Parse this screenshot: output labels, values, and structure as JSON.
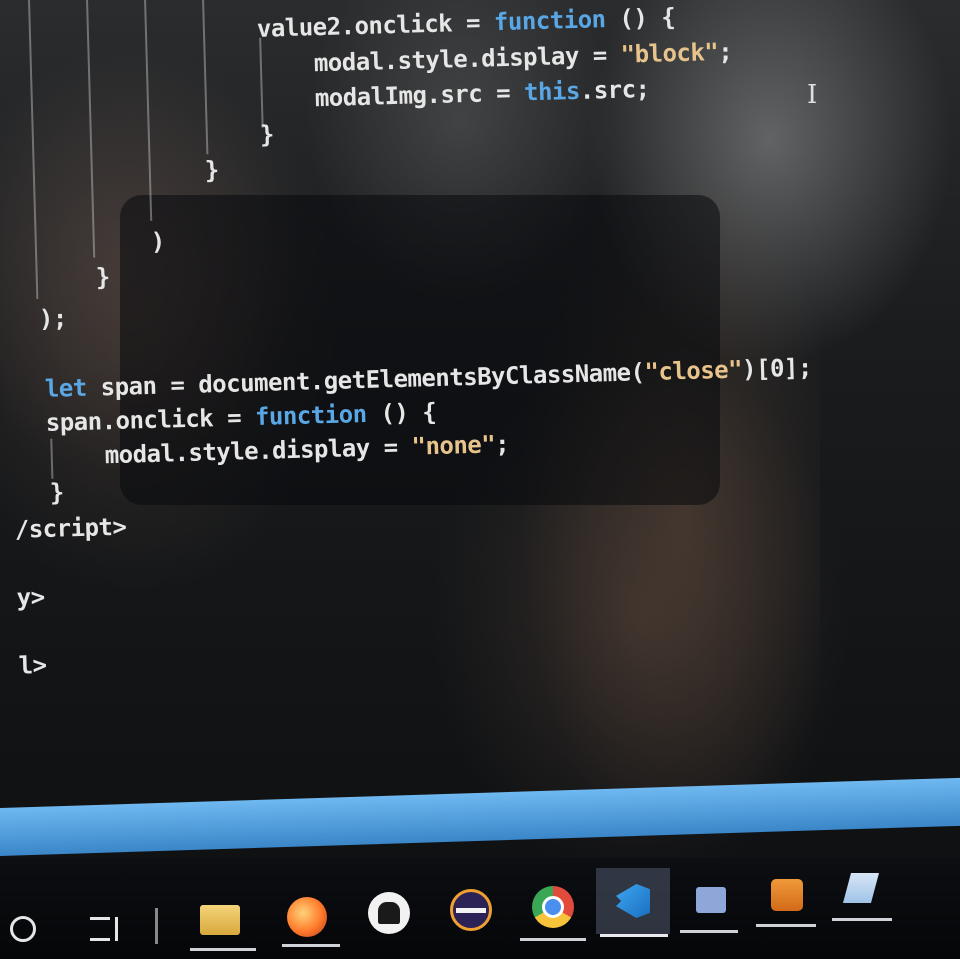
{
  "code": {
    "line1": "value2.onclick = ",
    "line1_kw": "function",
    "line1_tail": " () {",
    "line2_a": "modal.style.display = ",
    "line2_str": "\"block\"",
    "line2_end": ";",
    "line3_a": "modalImg.src = ",
    "line3_kw": "this",
    "line3_tail": ".src;",
    "close_brace_1": "}",
    "close_brace_2": "}",
    "close_paren": ")",
    "close_brace_3": "}",
    "close_paren_semi": ");",
    "let_kw": "let",
    "let_a": " span = document.getElementsByClassName(",
    "let_str": "\"close\"",
    "let_tail": ")[0];",
    "span_a": "span.onclick = ",
    "span_kw": "function",
    "span_tail": " () {",
    "none_a": "modal.style.display = ",
    "none_str": "\"none\"",
    "none_end": ";",
    "close_brace_4": "}",
    "end_script": "/script>",
    "end_body": "y>",
    "end_html": "l>"
  },
  "taskbar": {
    "icons": [
      "cortana-circle-icon",
      "task-view-icon",
      "file-explorer-icon",
      "firefox-icon",
      "inkscape-icon",
      "eclipse-icon",
      "chrome-icon",
      "vscode-icon",
      "ms-store-icon",
      "sublime-text-icon",
      "notepad-icon"
    ]
  },
  "colors": {
    "keyword": "#5aa7e6",
    "string": "#e8c48c",
    "text": "#e6e6e6",
    "taskbar_accent": "#3a86c8"
  }
}
